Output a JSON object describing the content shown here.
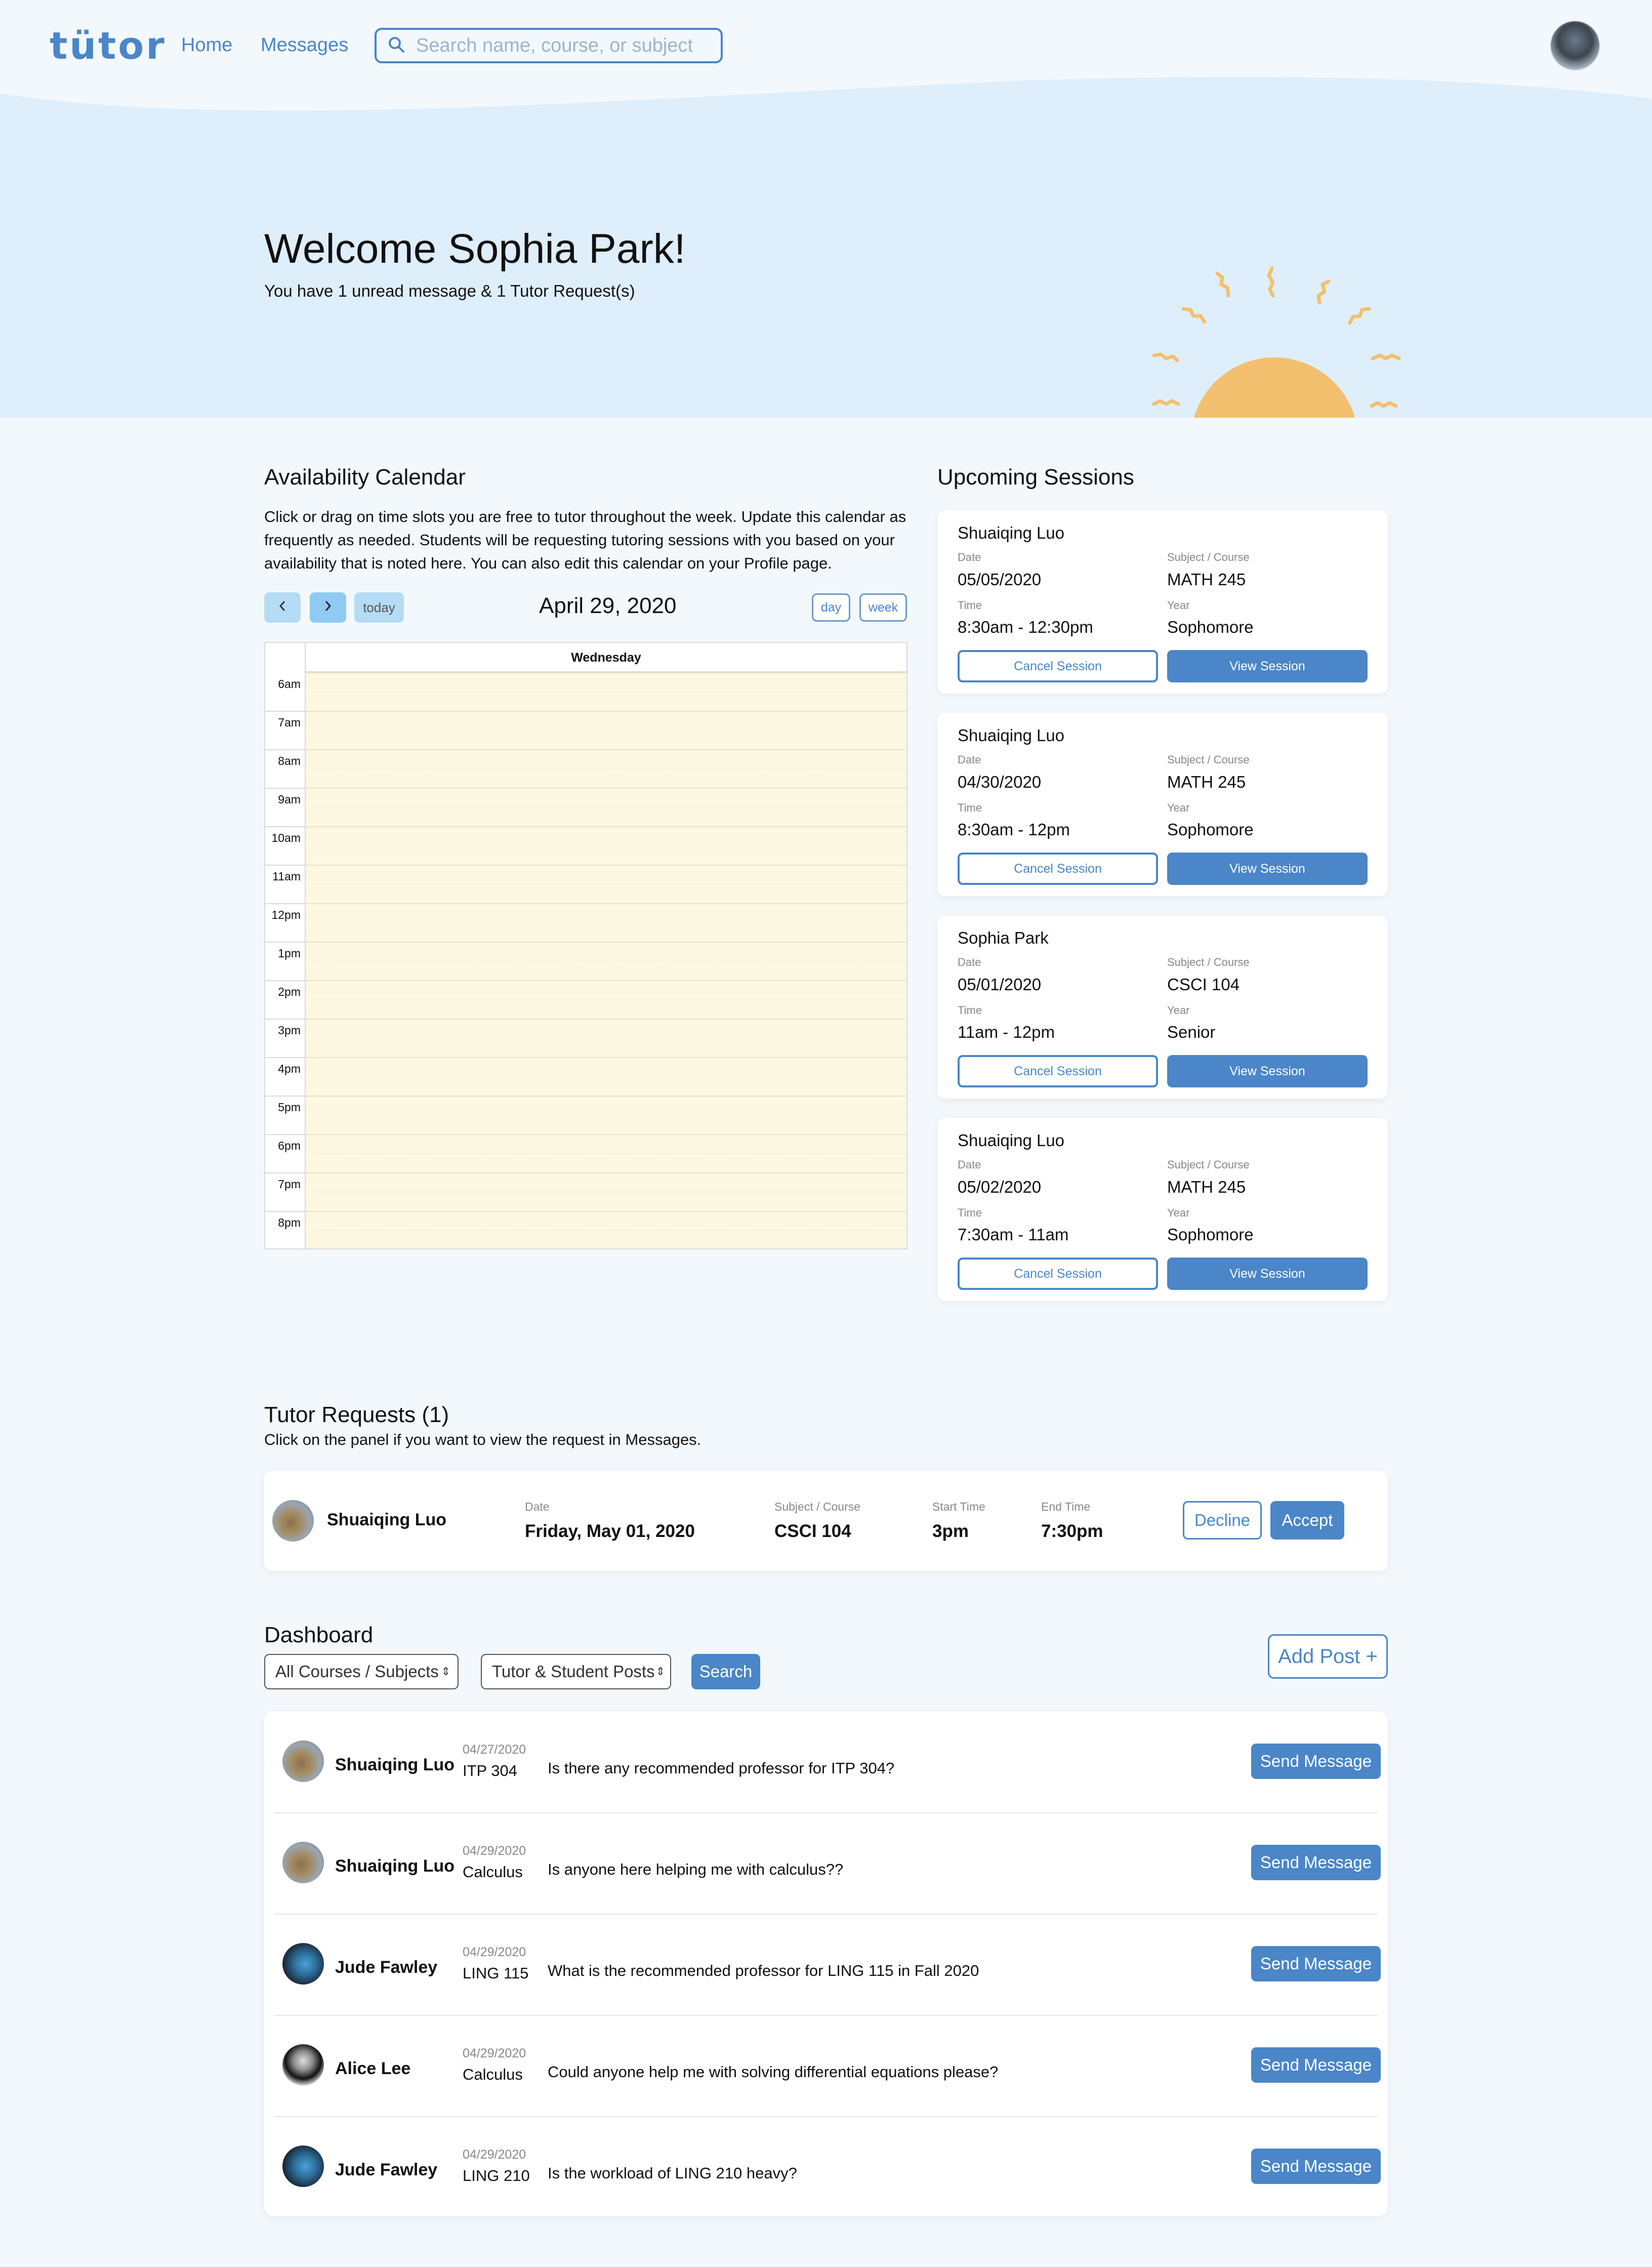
{
  "nav": {
    "logo": "tütor",
    "home": "Home",
    "messages": "Messages",
    "search_placeholder": "Search name, course, or subject"
  },
  "hero": {
    "title": "Welcome Sophia Park!",
    "subtitle": "You have 1 unread message & 1 Tutor Request(s)"
  },
  "calendar": {
    "title": "Availability Calendar",
    "description": "Click or drag on time slots you are free to tutor throughout the week. Update this calendar as frequently as needed. Students will be requesting tutoring sessions with you based on your availability that is noted here. You can also edit this calendar on your Profile page.",
    "today_label": "today",
    "date": "April 29, 2020",
    "day_label": "day",
    "week_label": "week",
    "column": "Wednesday",
    "hours": [
      "6am",
      "7am",
      "8am",
      "9am",
      "10am",
      "11am",
      "12pm",
      "1pm",
      "2pm",
      "3pm",
      "4pm",
      "5pm",
      "6pm",
      "7pm",
      "8pm"
    ]
  },
  "sessions": {
    "title": "Upcoming Sessions",
    "date_label": "Date",
    "subject_label": "Subject / Course",
    "time_label": "Time",
    "year_label": "Year",
    "cancel_label": "Cancel Session",
    "view_label": "View Session",
    "items": [
      {
        "name": "Shuaiqing Luo",
        "date": "05/05/2020",
        "subject": "MATH 245",
        "time": "8:30am - 12:30pm",
        "year": "Sophomore"
      },
      {
        "name": "Shuaiqing Luo",
        "date": "04/30/2020",
        "subject": "MATH 245",
        "time": "8:30am - 12pm",
        "year": "Sophomore"
      },
      {
        "name": "Sophia Park",
        "date": "05/01/2020",
        "subject": "CSCI 104",
        "time": "11am - 12pm",
        "year": "Senior"
      },
      {
        "name": "Shuaiqing Luo",
        "date": "05/02/2020",
        "subject": "MATH 245",
        "time": "7:30am - 11am",
        "year": "Sophomore"
      }
    ]
  },
  "requests": {
    "title": "Tutor Requests (1)",
    "subtitle": "Click on the panel if you want to view the request in Messages.",
    "item": {
      "name": "Shuaiqing Luo",
      "date_label": "Date",
      "date": "Friday, May 01, 2020",
      "subject_label": "Subject / Course",
      "subject": "CSCI 104",
      "start_label": "Start Time",
      "start": "3pm",
      "end_label": "End Time",
      "end": "7:30pm",
      "decline": "Decline",
      "accept": "Accept"
    }
  },
  "dashboard": {
    "title": "Dashboard",
    "filter_courses": "All Courses / Subjects",
    "filter_posts": "Tutor & Student Posts",
    "search_label": "Search",
    "add_post": "Add Post +",
    "send_label": "Send Message",
    "posts": [
      {
        "name": "Shuaiqing Luo",
        "date": "04/27/2020",
        "course": "ITP 304",
        "text": "Is there any recommended professor for ITP 304?",
        "avatar": "sl"
      },
      {
        "name": "Shuaiqing Luo",
        "date": "04/29/2020",
        "course": "Calculus",
        "text": "Is anyone here helping me with calculus??",
        "avatar": "sl"
      },
      {
        "name": "Jude Fawley",
        "date": "04/29/2020",
        "course": "LING 115",
        "text": "What is the recommended professor for LING 115 in Fall 2020",
        "avatar": "jf"
      },
      {
        "name": "Alice Lee",
        "date": "04/29/2020",
        "course": "Calculus",
        "text": "Could anyone help me with solving differential equations please?",
        "avatar": "al"
      },
      {
        "name": "Jude Fawley",
        "date": "04/29/2020",
        "course": "LING 210",
        "text": "Is the workload of LING 210 heavy?",
        "avatar": "jf"
      }
    ]
  },
  "colors": {
    "accent": "#4a86c8",
    "hero_bg": "#dfeefb",
    "calendar_fill": "#fdf8e1",
    "sun": "#f2c06f"
  }
}
